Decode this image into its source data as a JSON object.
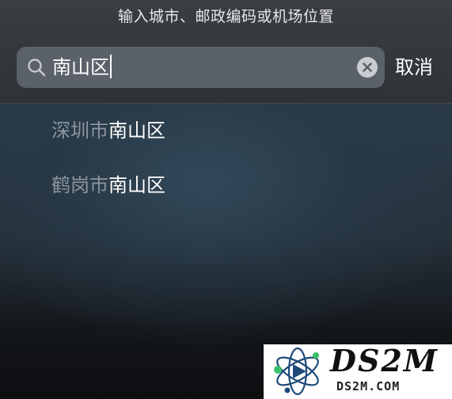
{
  "header": {
    "prompt": "输入城市、邮政编码或机场位置"
  },
  "search": {
    "value": "南山区",
    "cancel_label": "取消",
    "icon": "search-icon",
    "clear_icon": "clear-circle-icon"
  },
  "results": [
    {
      "prefix": "深圳市",
      "match": "南山区"
    },
    {
      "prefix": "鹤岗市",
      "match": "南山区"
    }
  ],
  "watermark": {
    "title": "DS2M",
    "subtitle": "DS2M.COM"
  },
  "colors": {
    "field_bg": "#5a6169",
    "text": "#ffffff",
    "muted_text": "#8b96a0",
    "header_bg": "#3a3e43"
  }
}
